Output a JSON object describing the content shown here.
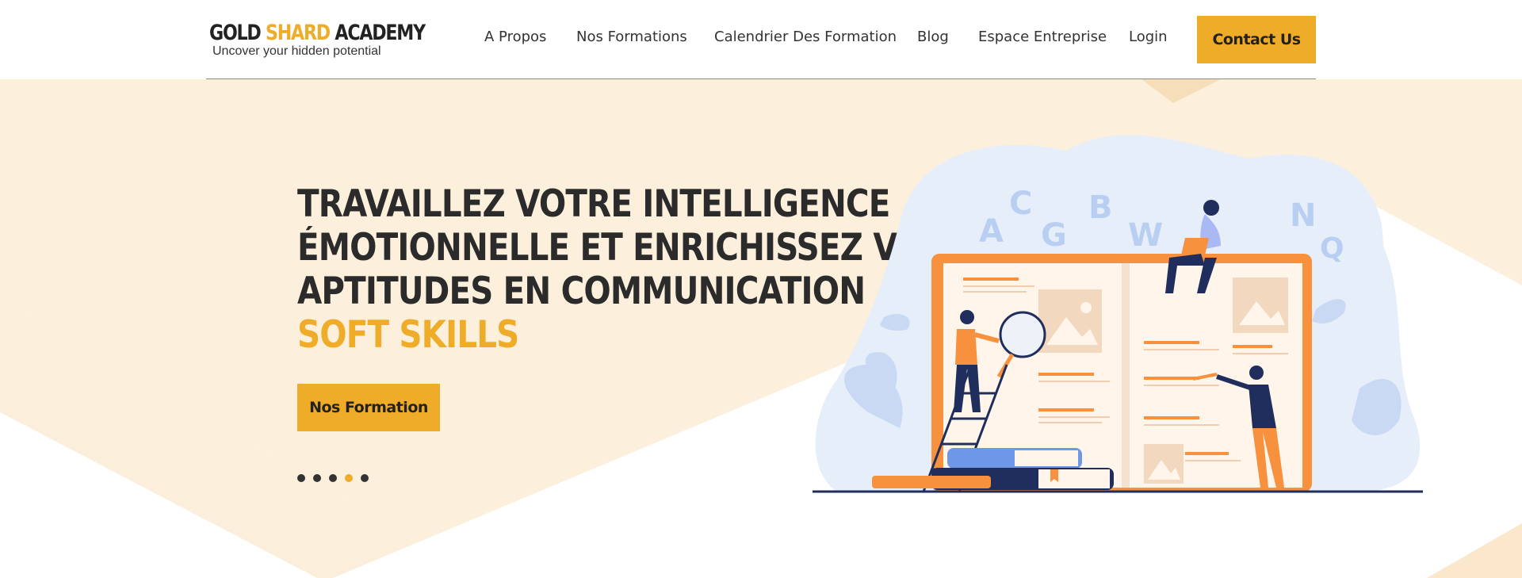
{
  "header": {
    "logo": {
      "title_part1": "GOLD ",
      "title_part2": "SHARD",
      "title_part3": " ACADEMY",
      "tagline": "Uncover  your hidden potential"
    },
    "nav": [
      {
        "label": "A Propos"
      },
      {
        "label": "Nos Formations"
      },
      {
        "label": "Calendrier Des Formation"
      },
      {
        "label": "Blog"
      },
      {
        "label": "Espace Entreprise"
      },
      {
        "label": "Login"
      }
    ],
    "contact_label": "Contact Us"
  },
  "hero": {
    "headline": [
      "TRAVAILLEZ VOTRE INTELLIGENCE",
      "ÉMOTIONNELLE ET ENRICHISSEZ VOS",
      "APTITUDES EN COMMUNICATION"
    ],
    "headline_accent": "SOFT SKILLS",
    "button_label": "Nos Formation",
    "slider": {
      "count": 5,
      "active_index": 3
    }
  },
  "illustration": {
    "letters": [
      "A",
      "C",
      "G",
      "B",
      "W",
      "N",
      "Q"
    ]
  },
  "colors": {
    "accent": "#efac28",
    "hero_bg": "#fcefdc",
    "text_dark": "#2b2b2b",
    "illustration_orange": "#f7913e",
    "illustration_navy": "#1f2e5c",
    "illustration_light_blue": "#e6eefa"
  }
}
